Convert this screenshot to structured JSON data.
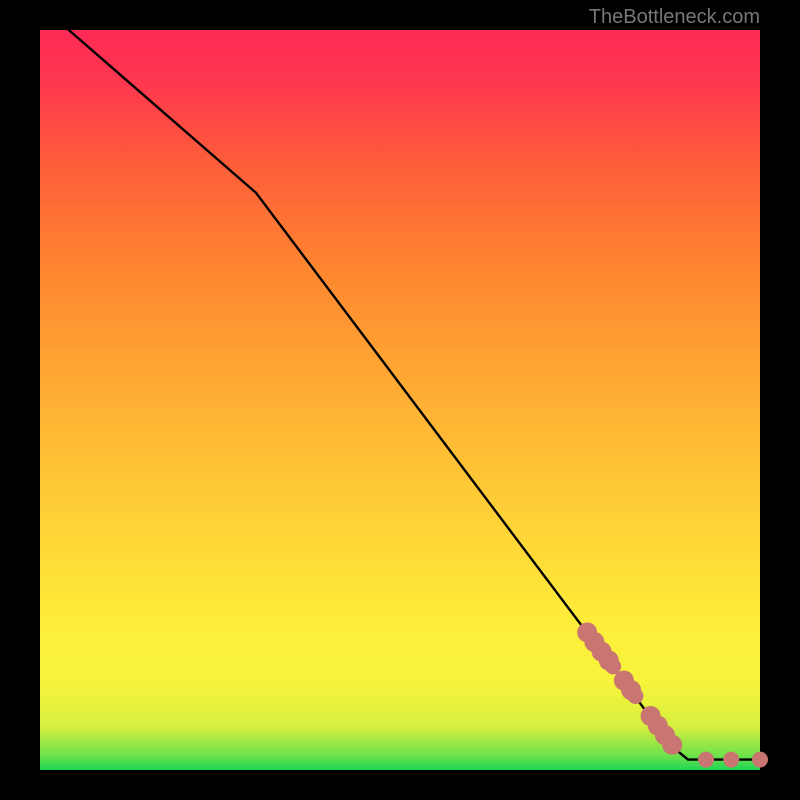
{
  "watermark": "TheBottleneck.com",
  "chart_data": {
    "type": "line",
    "title": "",
    "xlabel": "",
    "ylabel": "",
    "xlim": [
      0,
      100
    ],
    "ylim": [
      0,
      100
    ],
    "legend": false,
    "grid": false,
    "background": "heatmap-vertical-gradient",
    "gradient_stops": [
      {
        "pos": 0.0,
        "color": "#1fd655"
      },
      {
        "pos": 0.02,
        "color": "#6fe24a"
      },
      {
        "pos": 0.06,
        "color": "#d8ef3f"
      },
      {
        "pos": 0.12,
        "color": "#f7f33a"
      },
      {
        "pos": 0.18,
        "color": "#fdf03a"
      },
      {
        "pos": 0.26,
        "color": "#fee138"
      },
      {
        "pos": 0.38,
        "color": "#fec936"
      },
      {
        "pos": 0.52,
        "color": "#feab33"
      },
      {
        "pos": 0.68,
        "color": "#fe8530"
      },
      {
        "pos": 0.82,
        "color": "#fe5d3a"
      },
      {
        "pos": 0.92,
        "color": "#fe3a4e"
      },
      {
        "pos": 1.0,
        "color": "#fe2a56"
      }
    ],
    "series": [
      {
        "name": "curve-black",
        "color": "#000000",
        "points": [
          {
            "x": 4,
            "y": 100
          },
          {
            "x": 30,
            "y": 78
          },
          {
            "x": 88,
            "y": 3
          },
          {
            "x": 90,
            "y": 1.4
          },
          {
            "x": 100,
            "y": 1.4
          }
        ]
      }
    ],
    "markers": {
      "name": "bottleneck-points",
      "color": "#c97571",
      "radius_large": 10,
      "radius_small": 8,
      "points": [
        {
          "x": 76.0,
          "y": 18.6,
          "r": "large"
        },
        {
          "x": 77.0,
          "y": 17.3,
          "r": "large"
        },
        {
          "x": 78.0,
          "y": 16.0,
          "r": "large"
        },
        {
          "x": 79.0,
          "y": 14.8,
          "r": "large"
        },
        {
          "x": 79.6,
          "y": 14.0,
          "r": "small"
        },
        {
          "x": 81.1,
          "y": 12.1,
          "r": "large"
        },
        {
          "x": 82.1,
          "y": 10.8,
          "r": "large"
        },
        {
          "x": 82.7,
          "y": 10.0,
          "r": "small"
        },
        {
          "x": 84.8,
          "y": 7.3,
          "r": "large"
        },
        {
          "x": 85.8,
          "y": 6.0,
          "r": "large"
        },
        {
          "x": 86.8,
          "y": 4.7,
          "r": "large"
        },
        {
          "x": 87.8,
          "y": 3.4,
          "r": "large"
        },
        {
          "x": 92.5,
          "y": 1.4,
          "r": "small"
        },
        {
          "x": 96.0,
          "y": 1.4,
          "r": "small"
        },
        {
          "x": 100.0,
          "y": 1.4,
          "r": "small"
        }
      ]
    }
  }
}
